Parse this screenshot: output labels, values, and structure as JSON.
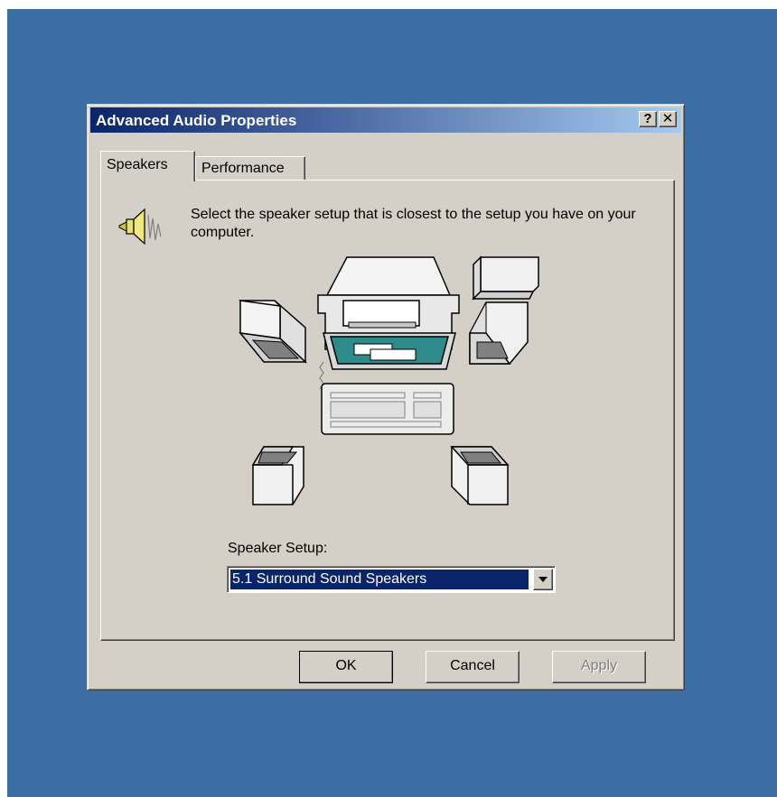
{
  "window": {
    "title": "Advanced Audio Properties"
  },
  "title_buttons": {
    "help": "?",
    "close": "✕"
  },
  "tabs": [
    {
      "label": "Speakers",
      "active": true
    },
    {
      "label": "Performance",
      "active": false
    }
  ],
  "speakers_tab": {
    "icon": "speaker-volume-icon",
    "instructions": "Select the speaker setup that is closest to the setup you have on your computer.",
    "diagram": "speaker-layout-illustration",
    "setup_label": "Speaker Setup:",
    "setup_value": "5.1 Surround Sound Speakers"
  },
  "buttons": {
    "ok": "OK",
    "cancel": "Cancel",
    "apply": "Apply"
  },
  "colors": {
    "desktop": "#3a6ea5",
    "dialog_face": "#d4d0c8",
    "titlebar_start": "#0a246a",
    "titlebar_end": "#a6caf0",
    "selection": "#0a246a",
    "monitor_screen": "#2e8b8b"
  }
}
